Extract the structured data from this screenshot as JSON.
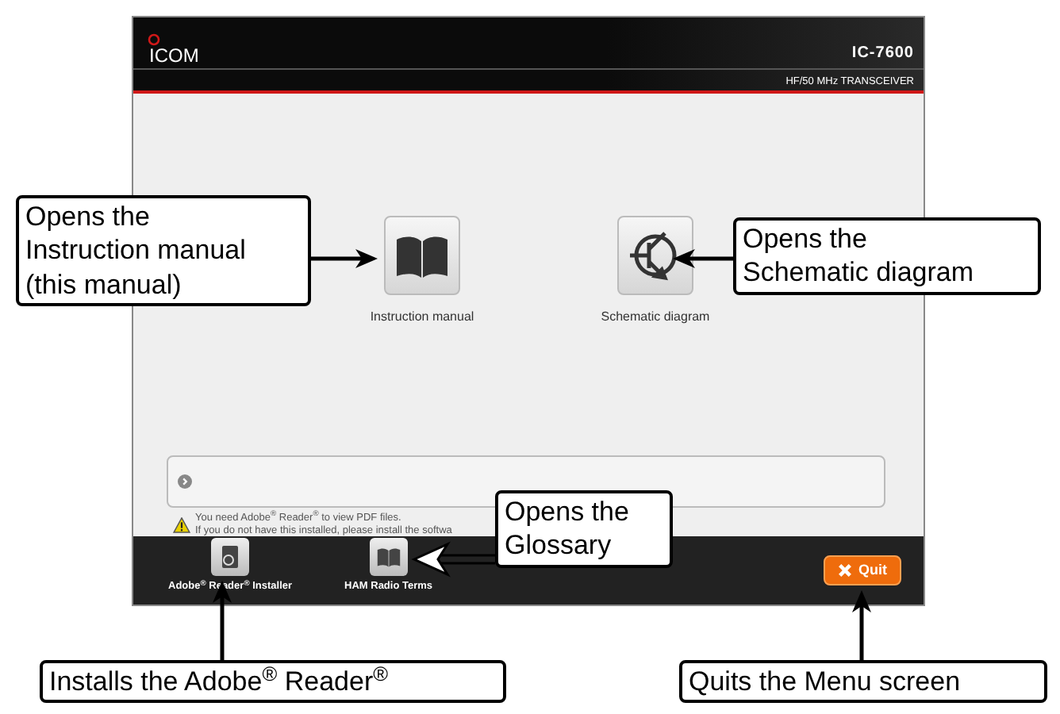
{
  "header": {
    "logo": "ICOM",
    "model": "IC-7600",
    "subtitle": "HF/50 MHz TRANSCEIVER"
  },
  "launch_buttons": [
    {
      "label": "Instruction manual",
      "kind": "book"
    },
    {
      "label": "Schematic diagram",
      "kind": "transistor"
    }
  ],
  "notice": [
    "You need Adobe$^{®}$ Reader$^{®}$ to view PDF files.",
    "If you do not have this installed, please install the softwa"
  ],
  "footer_items": [
    {
      "label": "Adobe$^{®}$ Reader$^{®}$ Installer",
      "kind": "installer"
    },
    {
      "label": "HAM Radio Terms",
      "kind": "book"
    }
  ],
  "quit_button": {
    "label": "Quit"
  },
  "callouts": [
    {
      "text": "Opens the\nInstruction manual\n(this manual)"
    },
    {
      "text": "Opens the\nSchematic diagram"
    },
    {
      "text": "Opens the\nGlossary"
    },
    {
      "text": "Installs the Adobe$^{®}$ Reader$^{®}$"
    },
    {
      "text": "Quits the Menu screen"
    }
  ]
}
